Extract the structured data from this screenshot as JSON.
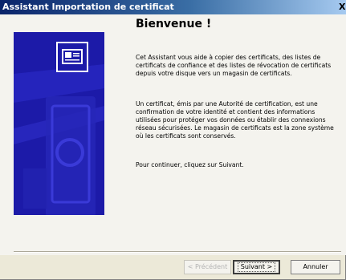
{
  "window": {
    "title": "Assistant Importation de certificat",
    "close_glyph": "X"
  },
  "content": {
    "heading": "Bienvenue !",
    "paragraph1": "Cet Assistant vous aide à copier des certificats, des listes de certificats de confiance et des listes de révocation de certificats depuis votre disque vers un magasin de certificats.",
    "paragraph2": "Un certificat, émis par une Autorité de certification, est une confirmation de votre identité et contient des informations utilisées pour protéger vos données ou établir des connexions réseau sécurisées. Le magasin de certificats est la zone système où les certificats sont conservés.",
    "paragraph3": "Pour continuer, cliquez sur Suivant."
  },
  "side_panel": {
    "icon": "certificate-icon",
    "background_color": "#1c1aa8"
  },
  "buttons": {
    "previous": "< Précédent",
    "next": "Suivant >",
    "cancel": "Annuler"
  },
  "colors": {
    "titlebar_start": "#0a246a",
    "titlebar_end": "#a6caf0",
    "dialog_background": "#f4f3ee"
  }
}
